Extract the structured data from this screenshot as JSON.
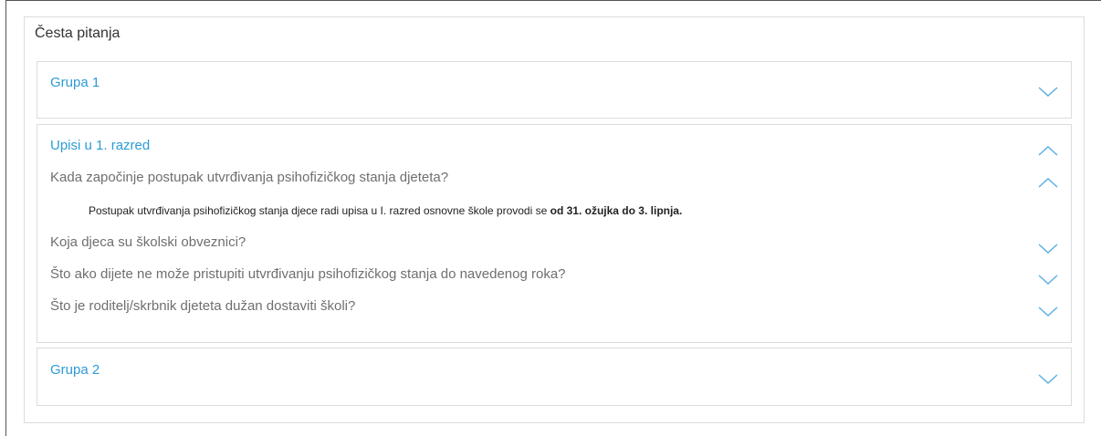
{
  "faq": {
    "title": "Česta pitanja",
    "groups": [
      {
        "title": "Grupa 1",
        "expanded": false,
        "icon": "chevron-down-icon"
      },
      {
        "title": "Upisi u 1. razred",
        "expanded": true,
        "icon": "chevron-up-icon",
        "questions": [
          {
            "text": "Kada započinje postupak utvrđivanja psihofizičkog stanja djeteta?",
            "expanded": true,
            "icon": "chevron-up-icon",
            "answer_plain": "Postupak utvrđivanja psihofizičkog stanja djece radi upisa u I. razred osnovne škole provodi se ",
            "answer_bold": "od 31. ožujka do 3. lipnja."
          },
          {
            "text": "Koja djeca su školski obveznici?",
            "expanded": false,
            "icon": "chevron-down-icon"
          },
          {
            "text": "Što ako dijete ne može pristupiti utvrđivanju psihofizičkog stanja do navedenog roka?",
            "expanded": false,
            "icon": "chevron-down-icon"
          },
          {
            "text": "Što je roditelj/skrbnik djeteta dužan dostaviti školi?",
            "expanded": false,
            "icon": "chevron-down-icon"
          }
        ]
      },
      {
        "title": "Grupa 2",
        "expanded": false,
        "icon": "chevron-down-icon"
      }
    ]
  },
  "colors": {
    "group_title": "#2e9bd6",
    "question_text": "#6f6f6f",
    "chevron": "#5aaee0",
    "border": "#dcdcdc"
  }
}
